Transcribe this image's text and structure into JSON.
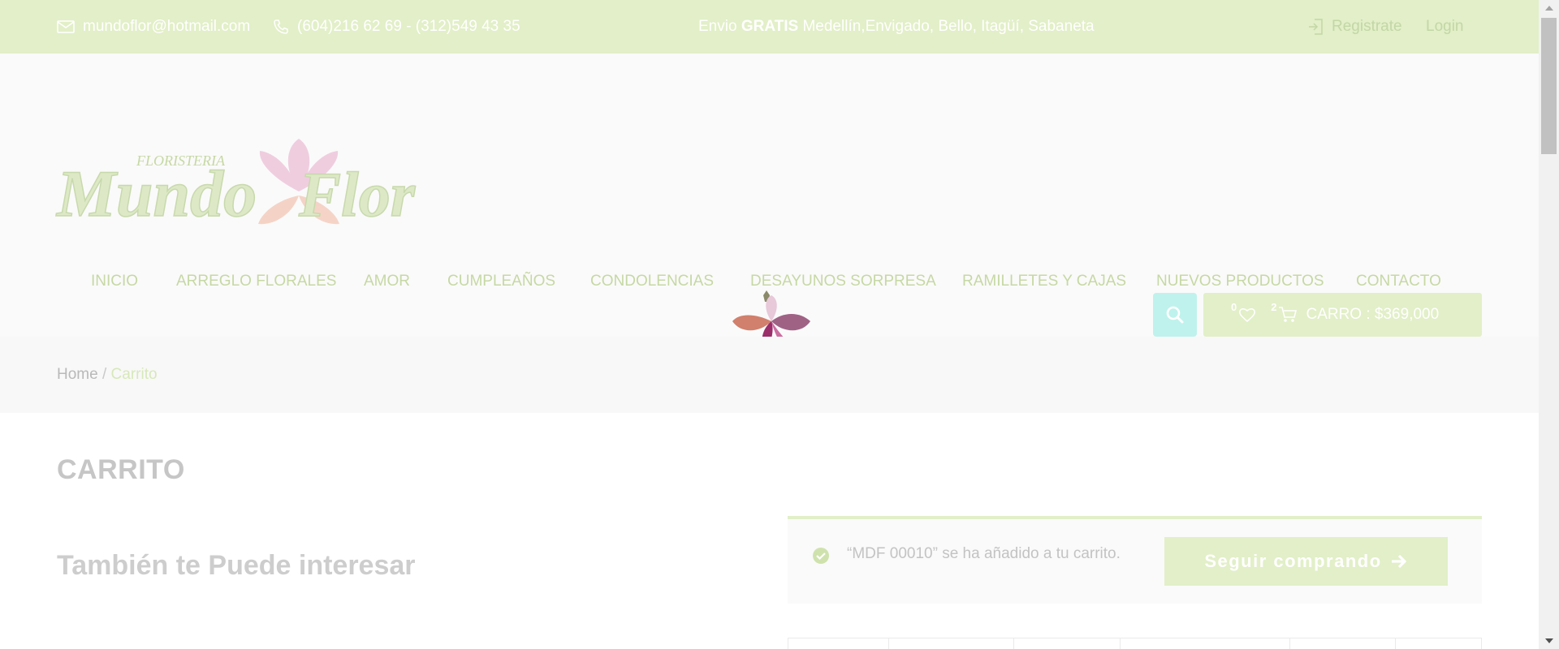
{
  "topbar": {
    "email": "mundoflor@hotmail.com",
    "phone": "(604)216 62 69 - (312)549 43 35",
    "promo_prefix": "Envio",
    "promo_bold": "GRATIS",
    "promo_rest": "Medellín,Envigado, Bello, Itagüí, Sabaneta",
    "register": "Registrate",
    "login": "Login"
  },
  "logo": {
    "small": "FLORISTERIA",
    "main": "Mundo",
    "main2": "Flor"
  },
  "nav": [
    {
      "label": "INICIO"
    },
    {
      "label": "ARREGLO FLORALES"
    },
    {
      "label": "AMOR"
    },
    {
      "label": "CUMPLEAÑOS"
    },
    {
      "label": "CONDOLENCIAS"
    },
    {
      "label": "DESAYUNOS SORPRESA"
    },
    {
      "label": "RAMILLETES Y CAJAS"
    },
    {
      "label": "NUEVOS PRODUCTOS"
    },
    {
      "label": "CONTACTO"
    }
  ],
  "cart": {
    "wishlist_count": "0",
    "cart_count": "2",
    "label": "CARRO : $369,000"
  },
  "breadcrumb": {
    "home": "Home",
    "separator": "/",
    "current": "Carrito"
  },
  "main": {
    "title": "CARRITO",
    "related_title": "También te Puede interesar"
  },
  "notice": {
    "message": "“MDF 00010” se ha añadido a tu carrito.",
    "button": "Seguir comprando"
  },
  "colors": {
    "accent": "#e2efc8",
    "search": "#bff2ec"
  }
}
